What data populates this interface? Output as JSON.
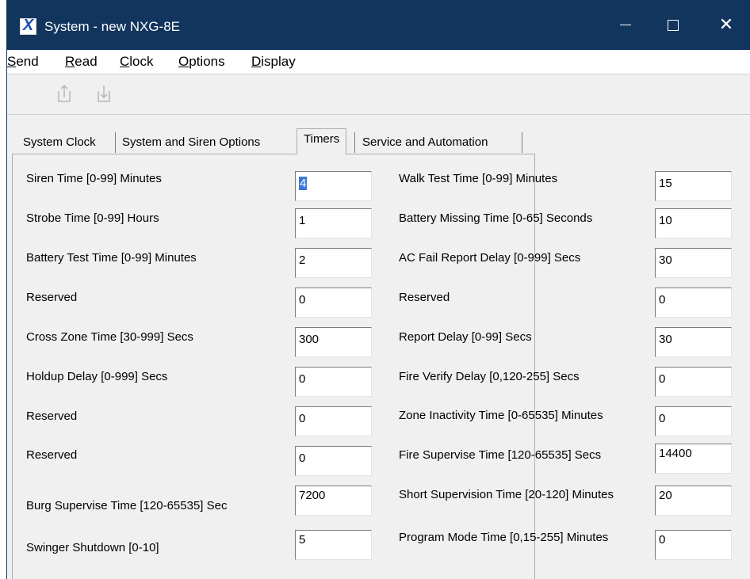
{
  "window": {
    "title": "System - new NXG-8E",
    "icon_letter": "X",
    "minimize_icon": "minimize-icon",
    "maximize_icon": "maximize-icon",
    "close_icon": "close-icon",
    "close_glyph": "✕"
  },
  "menu": [
    {
      "label": "Send",
      "accel": "S",
      "rest": "end"
    },
    {
      "label": "Read",
      "accel": "R",
      "rest": "ead"
    },
    {
      "label": "Clock",
      "accel": "C",
      "rest": "lock"
    },
    {
      "label": "Options",
      "accel": "O",
      "rest": "ptions"
    },
    {
      "label": "Display",
      "accel": "D",
      "rest": "isplay"
    }
  ],
  "toolbar": {
    "send_icon": "send-upload-icon",
    "read_icon": "read-download-icon"
  },
  "tabs": [
    {
      "label": "System Clock"
    },
    {
      "label": "System and Siren Options"
    },
    {
      "label": "Timers",
      "active": true
    },
    {
      "label": "Service and Automation"
    }
  ],
  "left_fields": [
    {
      "label": "Siren Time [0-99] Minutes",
      "value": "4"
    },
    {
      "label": "Strobe Time [0-99] Hours",
      "value": "1"
    },
    {
      "label": "Battery Test Time [0-99] Minutes",
      "value": "2"
    },
    {
      "label": "Reserved",
      "value": "0"
    },
    {
      "label": "Cross Zone Time [30-999] Secs",
      "value": "300"
    },
    {
      "label": "Holdup Delay [0-999] Secs",
      "value": "0"
    },
    {
      "label": "Reserved",
      "value": "0"
    },
    {
      "label": "Reserved",
      "value": "0"
    },
    {
      "label": "Burg Supervise Time [120-65535] Sec",
      "value": "7200"
    },
    {
      "label": "Swinger Shutdown [0-10]",
      "value": "5"
    }
  ],
  "right_fields": [
    {
      "label": "Walk Test Time [0-99] Minutes",
      "value": "15"
    },
    {
      "label": "Battery Missing Time [0-65] Seconds",
      "value": "10"
    },
    {
      "label": "AC Fail Report Delay [0-999] Secs",
      "value": "30"
    },
    {
      "label": "Reserved",
      "value": "0"
    },
    {
      "label": "Report Delay [0-99] Secs",
      "value": "30"
    },
    {
      "label": "Fire Verify Delay [0,120-255] Secs",
      "value": "0"
    },
    {
      "label": "Zone Inactivity Time [0-65535] Minutes",
      "value": "0"
    },
    {
      "label": "Fire Supervise Time [120-65535] Secs",
      "value": "14400"
    },
    {
      "label": "Short Supervision Time  [20-120] Minutes",
      "value": "20"
    },
    {
      "label": "Program Mode Time [0,15-255] Minutes",
      "value": "0"
    }
  ]
}
